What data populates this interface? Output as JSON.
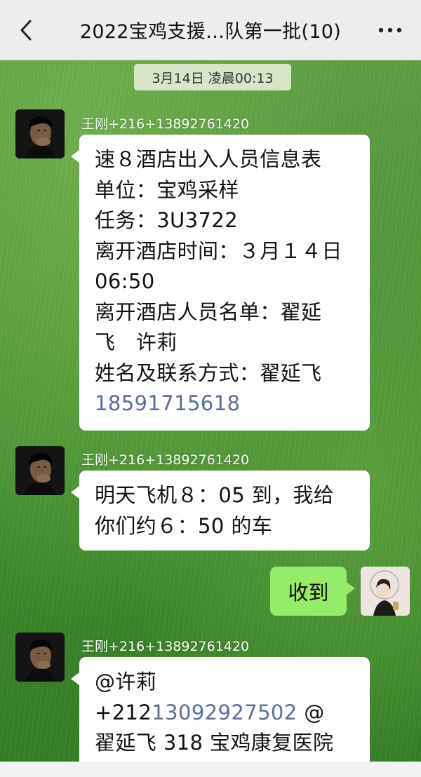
{
  "header": {
    "title": "2022宝鸡支援…队第一批(10)",
    "back_icon": "chevron-left-icon",
    "more_icon": "more-dots-icon"
  },
  "chat": {
    "timestamp": "3月14日 凌晨00:13",
    "messages": [
      {
        "sender": "王刚+216+13892761420",
        "lines": [
          "速８酒店出入人员信息表",
          "单位：宝鸡采样",
          "任务：3U3722",
          "离开酒店时间：３月１４日",
          "06:50",
          "离开酒店人员名单：翟延",
          "飞　许莉",
          "姓名及联系方式：翟延飞"
        ],
        "phone": "18591715618"
      },
      {
        "sender": "王刚+216+13892761420",
        "lines": [
          "明天飞机８：05 到，我给",
          "你们约６：50 的车"
        ]
      },
      {
        "self": true,
        "text": "收到"
      },
      {
        "sender": "王刚+216+13892761420",
        "line1": "@许莉",
        "line2_prefix": "+212",
        "line2_phone": "13092927502",
        "line2_suffix": " @",
        "line3": "翟延飞 318 宝鸡康复医院"
      }
    ]
  },
  "colors": {
    "header_bg": "#ededed",
    "self_bubble": "#95ec69",
    "other_bubble": "#ffffff",
    "link": "#5b6d94",
    "timestamp_bg": "#d7e6c7"
  }
}
